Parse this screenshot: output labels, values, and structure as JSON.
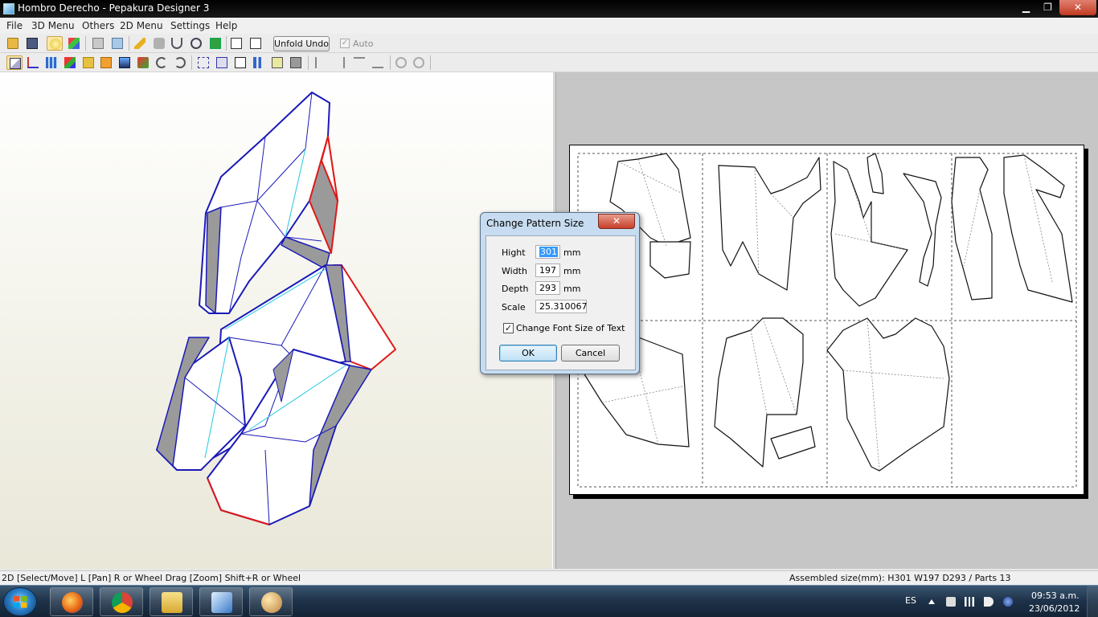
{
  "window": {
    "title": "Hombro Derecho - Pepakura Designer 3",
    "min_icon": "minimize-icon",
    "max_icon": "maximize-icon",
    "close_icon": "close-icon",
    "min_glyph": "▁",
    "max_glyph": "❐",
    "close_glyph": "✕"
  },
  "menu": [
    "File",
    "3D Menu",
    "Others",
    "2D Menu",
    "Settings",
    "Help"
  ],
  "toolbar": {
    "unfold_undo": "Unfold Undo",
    "auto_label": "Auto",
    "auto_checked": "✓"
  },
  "dialog": {
    "title": "Change Pattern Size",
    "close_glyph": "✕",
    "fields": [
      {
        "label": "Hight",
        "value": "301",
        "unit": "mm"
      },
      {
        "label": "Width",
        "value": "197",
        "unit": "mm"
      },
      {
        "label": "Depth",
        "value": "293",
        "unit": "mm"
      },
      {
        "label": "Scale",
        "value": "25.310067",
        "unit": ""
      }
    ],
    "change_font_label": "Change Font Size of Text",
    "change_font_checked": "✓",
    "ok_label": "OK",
    "cancel_label": "Cancel"
  },
  "status": {
    "left": "2D [Select/Move] L [Pan] R or Wheel Drag [Zoom] Shift+R or Wheel",
    "right": "Assembled size(mm): H301 W197 D293 / Parts 13"
  },
  "taskbar": {
    "apps": [
      "firefox-icon",
      "chrome-icon",
      "explorer-icon",
      "pepakura-icon",
      "paint-icon"
    ],
    "language": "ES",
    "time": "09:53 a.m.",
    "date": "23/06/2012"
  },
  "colors": {
    "edge_blue": "#1a1ab8",
    "edge_red": "#e01818",
    "edge_cyan": "#22c8e0",
    "accent_gray": "#9a9a9a"
  }
}
